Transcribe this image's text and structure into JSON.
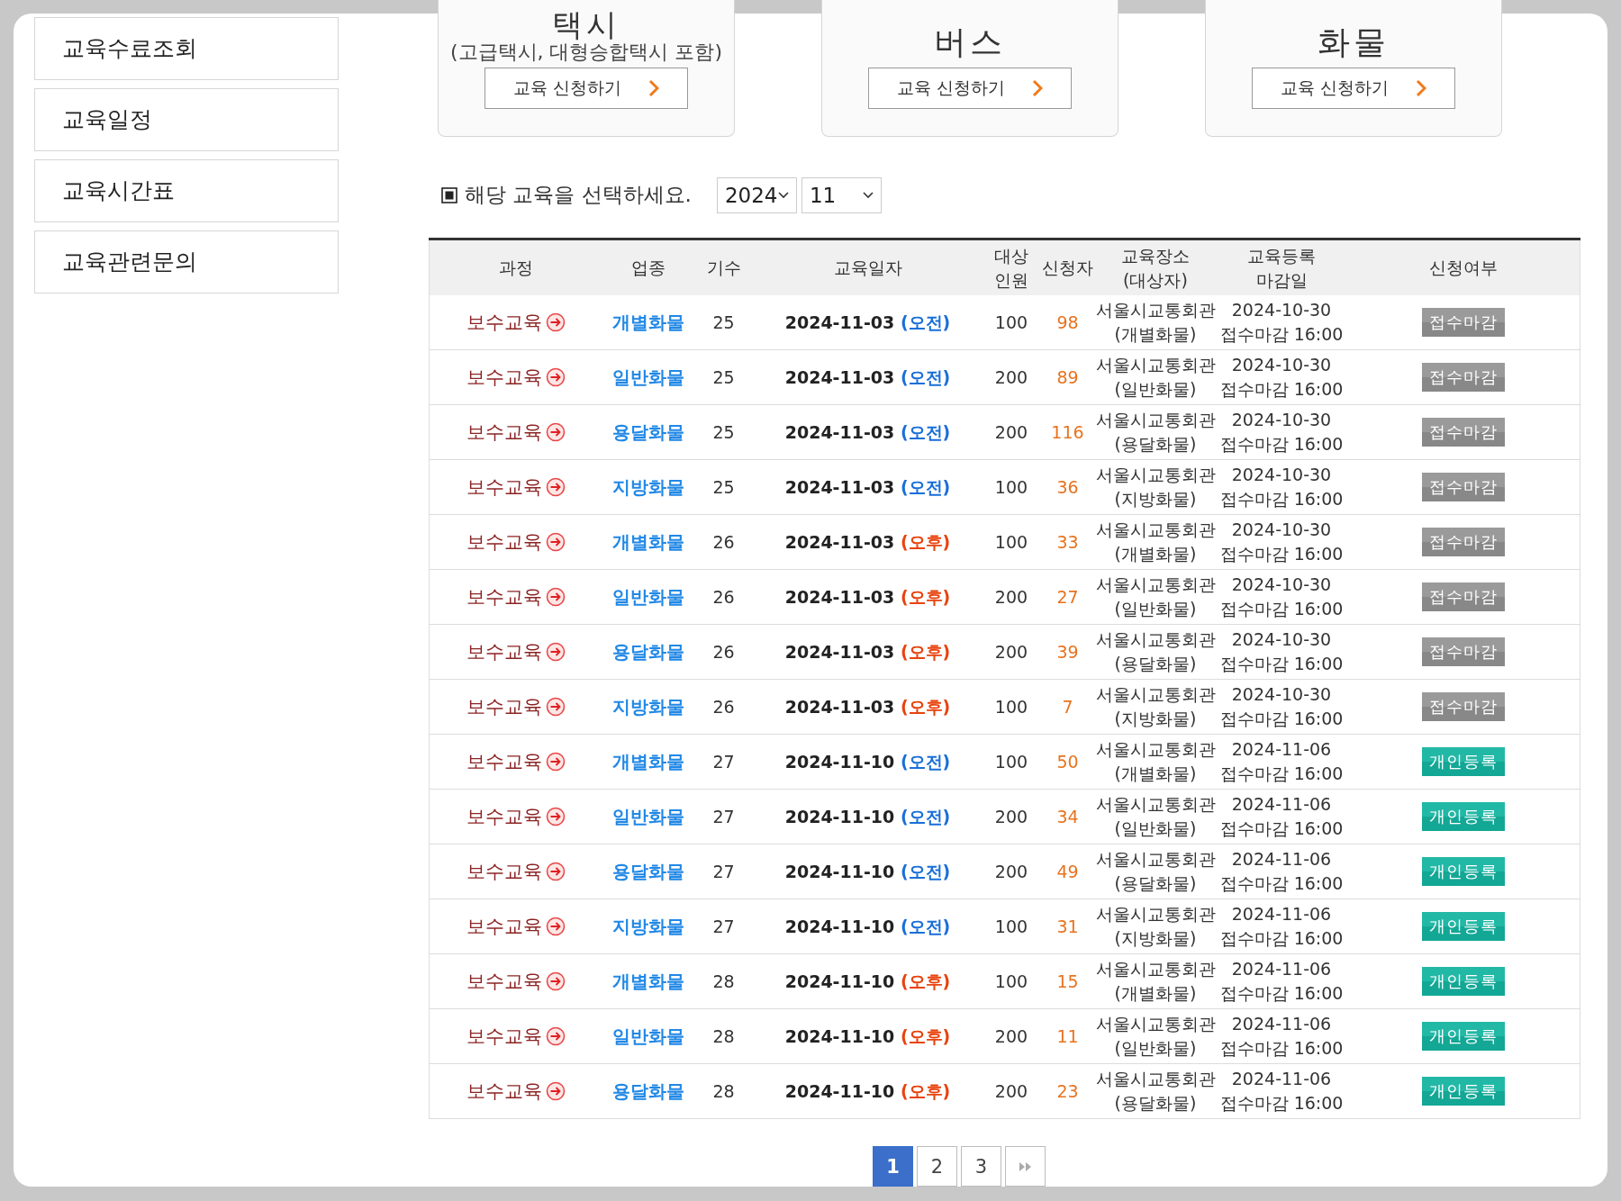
{
  "sidebar": {
    "items": [
      {
        "label": "교육수료조회"
      },
      {
        "label": "교육일정"
      },
      {
        "label": "교육시간표"
      },
      {
        "label": "교육관련문의"
      }
    ]
  },
  "cards": [
    {
      "title": "택시",
      "subtitle": "(고급택시, 대형승합택시 포함)",
      "button": "교육 신청하기"
    },
    {
      "title": "버스",
      "button": "교육 신청하기"
    },
    {
      "title": "화물",
      "button": "교육 신청하기"
    }
  ],
  "filter": {
    "label": "해당 교육을 선택하세요.",
    "year": "2024",
    "month": "11"
  },
  "table": {
    "columns": [
      [
        "과정"
      ],
      [
        "업종"
      ],
      [
        "기수"
      ],
      [
        "교육일자"
      ],
      [
        "대상",
        "인원"
      ],
      [
        "신청자"
      ],
      [
        "교육장소",
        "(대상자)"
      ],
      [
        "교육등록",
        "마감일"
      ],
      [
        "신청여부"
      ]
    ],
    "rows": [
      {
        "course": "보수교육",
        "type": "개별화물",
        "round": "25",
        "date": "2024-11-03",
        "session": {
          "text": "(오전)",
          "kind": "am"
        },
        "capacity": "100",
        "applicants": "98",
        "place": [
          "서울시교통회관",
          "(개별화물)"
        ],
        "deadline": [
          "2024-10-30",
          "접수마감 16:00"
        ],
        "status": {
          "label": "접수마감",
          "kind": "closed"
        }
      },
      {
        "course": "보수교육",
        "type": "일반화물",
        "round": "25",
        "date": "2024-11-03",
        "session": {
          "text": "(오전)",
          "kind": "am"
        },
        "capacity": "200",
        "applicants": "89",
        "place": [
          "서울시교통회관",
          "(일반화물)"
        ],
        "deadline": [
          "2024-10-30",
          "접수마감 16:00"
        ],
        "status": {
          "label": "접수마감",
          "kind": "closed"
        }
      },
      {
        "course": "보수교육",
        "type": "용달화물",
        "round": "25",
        "date": "2024-11-03",
        "session": {
          "text": "(오전)",
          "kind": "am"
        },
        "capacity": "200",
        "applicants": "116",
        "place": [
          "서울시교통회관",
          "(용달화물)"
        ],
        "deadline": [
          "2024-10-30",
          "접수마감 16:00"
        ],
        "status": {
          "label": "접수마감",
          "kind": "closed"
        }
      },
      {
        "course": "보수교육",
        "type": "지방화물",
        "round": "25",
        "date": "2024-11-03",
        "session": {
          "text": "(오전)",
          "kind": "am"
        },
        "capacity": "100",
        "applicants": "36",
        "place": [
          "서울시교통회관",
          "(지방화물)"
        ],
        "deadline": [
          "2024-10-30",
          "접수마감 16:00"
        ],
        "status": {
          "label": "접수마감",
          "kind": "closed"
        }
      },
      {
        "course": "보수교육",
        "type": "개별화물",
        "round": "26",
        "date": "2024-11-03",
        "session": {
          "text": "(오후)",
          "kind": "pm"
        },
        "capacity": "100",
        "applicants": "33",
        "place": [
          "서울시교통회관",
          "(개별화물)"
        ],
        "deadline": [
          "2024-10-30",
          "접수마감 16:00"
        ],
        "status": {
          "label": "접수마감",
          "kind": "closed"
        }
      },
      {
        "course": "보수교육",
        "type": "일반화물",
        "round": "26",
        "date": "2024-11-03",
        "session": {
          "text": "(오후)",
          "kind": "pm"
        },
        "capacity": "200",
        "applicants": "27",
        "place": [
          "서울시교통회관",
          "(일반화물)"
        ],
        "deadline": [
          "2024-10-30",
          "접수마감 16:00"
        ],
        "status": {
          "label": "접수마감",
          "kind": "closed"
        }
      },
      {
        "course": "보수교육",
        "type": "용달화물",
        "round": "26",
        "date": "2024-11-03",
        "session": {
          "text": "(오후)",
          "kind": "pm"
        },
        "capacity": "200",
        "applicants": "39",
        "place": [
          "서울시교통회관",
          "(용달화물)"
        ],
        "deadline": [
          "2024-10-30",
          "접수마감 16:00"
        ],
        "status": {
          "label": "접수마감",
          "kind": "closed"
        }
      },
      {
        "course": "보수교육",
        "type": "지방화물",
        "round": "26",
        "date": "2024-11-03",
        "session": {
          "text": "(오후)",
          "kind": "pm"
        },
        "capacity": "100",
        "applicants": "7",
        "place": [
          "서울시교통회관",
          "(지방화물)"
        ],
        "deadline": [
          "2024-10-30",
          "접수마감 16:00"
        ],
        "status": {
          "label": "접수마감",
          "kind": "closed"
        }
      },
      {
        "course": "보수교육",
        "type": "개별화물",
        "round": "27",
        "date": "2024-11-10",
        "session": {
          "text": "(오전)",
          "kind": "am"
        },
        "capacity": "100",
        "applicants": "50",
        "place": [
          "서울시교통회관",
          "(개별화물)"
        ],
        "deadline": [
          "2024-11-06",
          "접수마감 16:00"
        ],
        "status": {
          "label": "개인등록",
          "kind": "open"
        }
      },
      {
        "course": "보수교육",
        "type": "일반화물",
        "round": "27",
        "date": "2024-11-10",
        "session": {
          "text": "(오전)",
          "kind": "am"
        },
        "capacity": "200",
        "applicants": "34",
        "place": [
          "서울시교통회관",
          "(일반화물)"
        ],
        "deadline": [
          "2024-11-06",
          "접수마감 16:00"
        ],
        "status": {
          "label": "개인등록",
          "kind": "open"
        }
      },
      {
        "course": "보수교육",
        "type": "용달화물",
        "round": "27",
        "date": "2024-11-10",
        "session": {
          "text": "(오전)",
          "kind": "am"
        },
        "capacity": "200",
        "applicants": "49",
        "place": [
          "서울시교통회관",
          "(용달화물)"
        ],
        "deadline": [
          "2024-11-06",
          "접수마감 16:00"
        ],
        "status": {
          "label": "개인등록",
          "kind": "open"
        }
      },
      {
        "course": "보수교육",
        "type": "지방화물",
        "round": "27",
        "date": "2024-11-10",
        "session": {
          "text": "(오전)",
          "kind": "am"
        },
        "capacity": "100",
        "applicants": "31",
        "place": [
          "서울시교통회관",
          "(지방화물)"
        ],
        "deadline": [
          "2024-11-06",
          "접수마감 16:00"
        ],
        "status": {
          "label": "개인등록",
          "kind": "open"
        }
      },
      {
        "course": "보수교육",
        "type": "개별화물",
        "round": "28",
        "date": "2024-11-10",
        "session": {
          "text": "(오후)",
          "kind": "pm"
        },
        "capacity": "100",
        "applicants": "15",
        "place": [
          "서울시교통회관",
          "(개별화물)"
        ],
        "deadline": [
          "2024-11-06",
          "접수마감 16:00"
        ],
        "status": {
          "label": "개인등록",
          "kind": "open"
        }
      },
      {
        "course": "보수교육",
        "type": "일반화물",
        "round": "28",
        "date": "2024-11-10",
        "session": {
          "text": "(오후)",
          "kind": "pm"
        },
        "capacity": "200",
        "applicants": "11",
        "place": [
          "서울시교통회관",
          "(일반화물)"
        ],
        "deadline": [
          "2024-11-06",
          "접수마감 16:00"
        ],
        "status": {
          "label": "개인등록",
          "kind": "open"
        }
      },
      {
        "course": "보수교육",
        "type": "용달화물",
        "round": "28",
        "date": "2024-11-10",
        "session": {
          "text": "(오후)",
          "kind": "pm"
        },
        "capacity": "200",
        "applicants": "23",
        "place": [
          "서울시교통회관",
          "(용달화물)"
        ],
        "deadline": [
          "2024-11-06",
          "접수마감 16:00"
        ],
        "status": {
          "label": "개인등록",
          "kind": "open"
        }
      }
    ]
  },
  "pagination": {
    "pages": [
      {
        "label": "1",
        "selected": true
      },
      {
        "label": "2",
        "selected": false
      },
      {
        "label": "3",
        "selected": false
      }
    ]
  }
}
